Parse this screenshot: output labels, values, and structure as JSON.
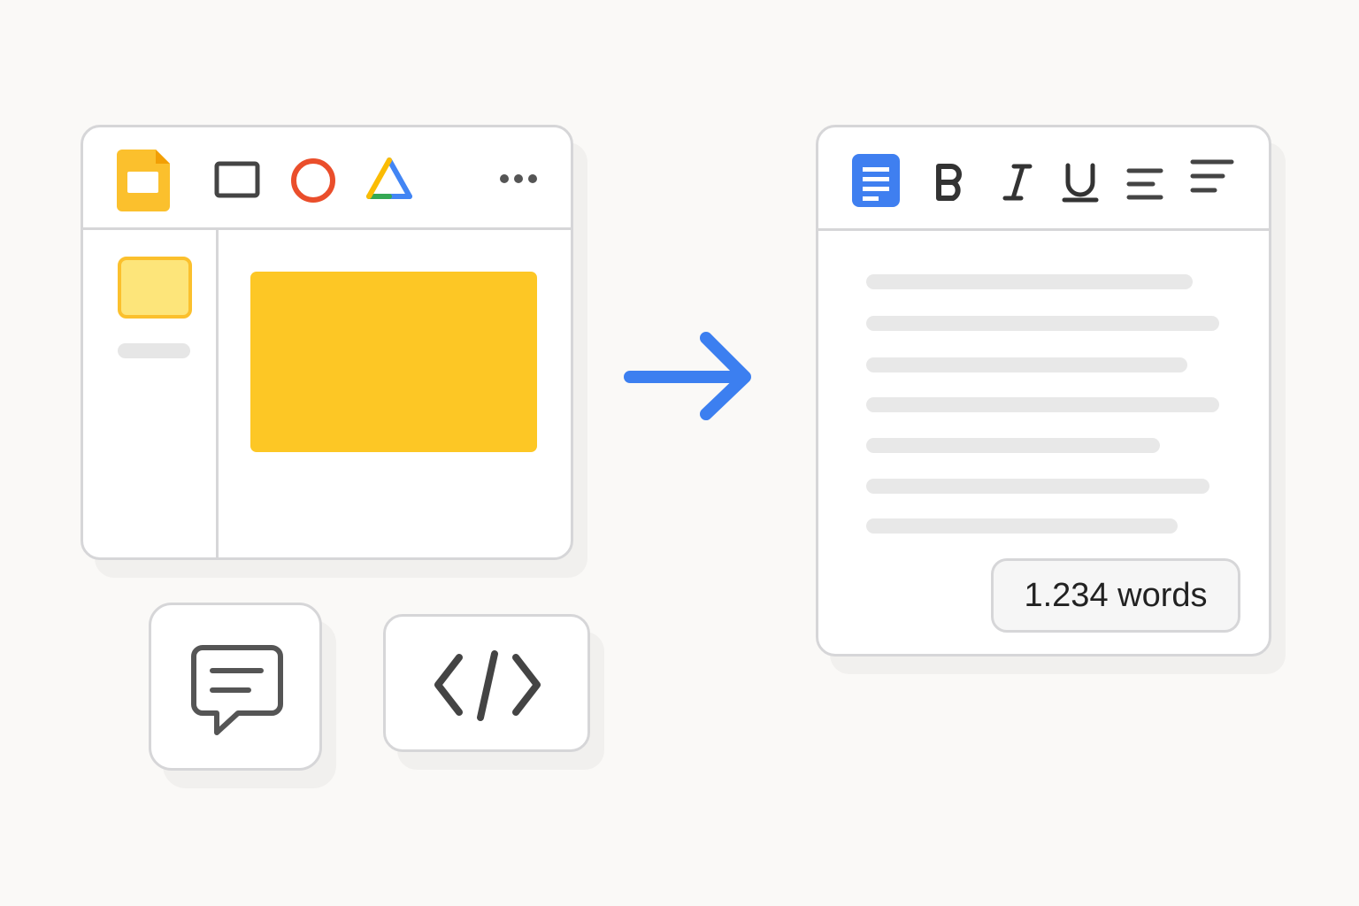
{
  "slides_window": {
    "toolbar_icons": [
      "slides-logo-icon",
      "rectangle-shape-icon",
      "circle-shape-icon",
      "triangle-shape-icon",
      "more-icon"
    ],
    "colors": {
      "slides_yellow": "#fbc02d",
      "circle_red": "#ea4e2b",
      "thumbnail_fill": "#fde57a",
      "slide_fill": "#fdc725"
    }
  },
  "arrow": {
    "icon": "arrow-right-icon",
    "color": "#3c7ff0"
  },
  "docs_window": {
    "toolbar_icons": [
      "docs-logo-icon",
      "bold-icon",
      "italic-icon",
      "underline-icon",
      "align-left-icon",
      "align-justify-icon"
    ],
    "word_count": "1.234 words",
    "colors": {
      "docs_blue": "#3f7ff0"
    }
  },
  "tiles": {
    "comment": {
      "icon": "comment-icon"
    },
    "code": {
      "icon": "code-icon"
    }
  }
}
